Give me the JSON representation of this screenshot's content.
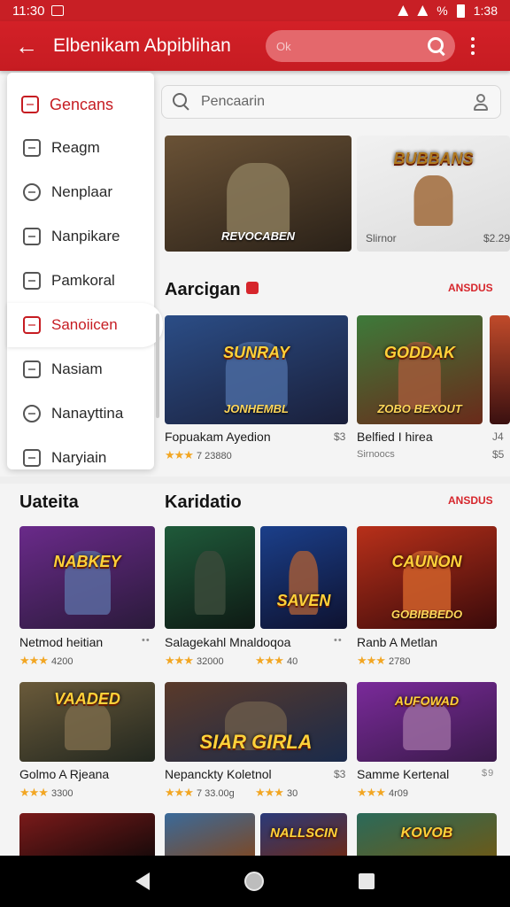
{
  "status_bar": {
    "time_left": "11:30",
    "battery_pct": "%",
    "time_right": "1:38"
  },
  "app_bar": {
    "title": "Elbenikam Abpiblihan",
    "search_placeholder": "Ok"
  },
  "drawer": {
    "header": "Gencans",
    "items": [
      {
        "label": "Reagm",
        "icon": "bag-icon"
      },
      {
        "label": "Nenplaar",
        "icon": "circle-g-icon"
      },
      {
        "label": "Nanpikare",
        "icon": "image-icon"
      },
      {
        "label": "Pamkoral",
        "icon": "camera-icon"
      },
      {
        "label": "Sanoiicen",
        "icon": "list-icon",
        "active": true
      },
      {
        "label": "Nasiam",
        "icon": "camera-icon"
      },
      {
        "label": "Nanayttina",
        "icon": "badge-icon"
      },
      {
        "label": "Naryiain",
        "icon": "grid-icon"
      }
    ]
  },
  "main_search": {
    "placeholder": "Pencaarin"
  },
  "featured": [
    {
      "caption": "REVOCABEN",
      "colors": [
        "#6a5236",
        "#2a2118"
      ]
    },
    {
      "caption": "BUBBANS",
      "sub": "Slirnor",
      "price": "$2.29",
      "colors": [
        "#f1f1f1",
        "#dcdcdc"
      ]
    }
  ],
  "section_1": {
    "title": "Aarcigan",
    "link": "ANSDUS",
    "games": [
      {
        "caption": "SUNRAY",
        "caption2": "JONHEMBL",
        "title": "Fopuakam Ayedion",
        "sub": "$3",
        "rating": "7 23880",
        "colors": [
          "#2b4d86",
          "#1a1f3a"
        ]
      },
      {
        "caption": "GODDAK",
        "caption2": "ZOBO BEXOUT",
        "title": "Belfied I hirea",
        "sub": "Sirnoocs",
        "extra": "J4",
        "extra2": "$5",
        "colors": [
          "#3d7a3a",
          "#6a2a1a"
        ]
      }
    ]
  },
  "section_2": {
    "title": "Uateita"
  },
  "section_3": {
    "title": "Karidatio",
    "link": "ANSDUS",
    "row1": [
      {
        "caption": "NABKEY",
        "title": "Netmod heitian",
        "dots": "••",
        "rating": "4200",
        "colors": [
          "#6a2a8a",
          "#2a1a3a"
        ]
      },
      {
        "caption": "",
        "title": "Salagekahl Mnaldoqoa",
        "dots": "••",
        "rating": "32000",
        "rating2": "40",
        "colors": [
          "#1f5a3a",
          "#0e1a14"
        ]
      },
      {
        "caption": "SAVEN",
        "title": "",
        "colors": [
          "#1b3f8a",
          "#0e1230"
        ]
      },
      {
        "caption": "CAUNON",
        "caption2": "GOBIBBEDO",
        "title": "Ranb A Metlan",
        "rating": "2780",
        "colors": [
          "#b8301a",
          "#3a0a0a"
        ]
      }
    ],
    "row2": [
      {
        "caption": "VAADED",
        "title": "Golmo A Rjeana",
        "rating": "3300",
        "colors": [
          "#6a5a3a",
          "#22271f"
        ]
      },
      {
        "caption": "SIAR GIRLA",
        "title": "Nepanckty Koletnol",
        "sub": "$3",
        "rating": "7 33.00g",
        "rating2": "30",
        "colors": [
          "#5a3a2a",
          "#1a2a4a"
        ]
      },
      {
        "caption": "AUFOWAD",
        "title": "Samme Kertenal",
        "dots": "$9",
        "rating": "4r09",
        "colors": [
          "#7a2a9a",
          "#3a1a4a"
        ]
      }
    ],
    "row3": [
      {
        "caption": "",
        "colors": [
          "#7a1a1a",
          "#1a0a0a"
        ]
      },
      {
        "caption": "",
        "colors": [
          "#3a6a9a",
          "#7a4a2a"
        ]
      },
      {
        "caption": "NALLSCIN",
        "colors": [
          "#2a3a7a",
          "#6a2a1a"
        ]
      },
      {
        "caption": "KOVOB",
        "colors": [
          "#2a6a5a",
          "#6a5a1a"
        ]
      }
    ]
  }
}
